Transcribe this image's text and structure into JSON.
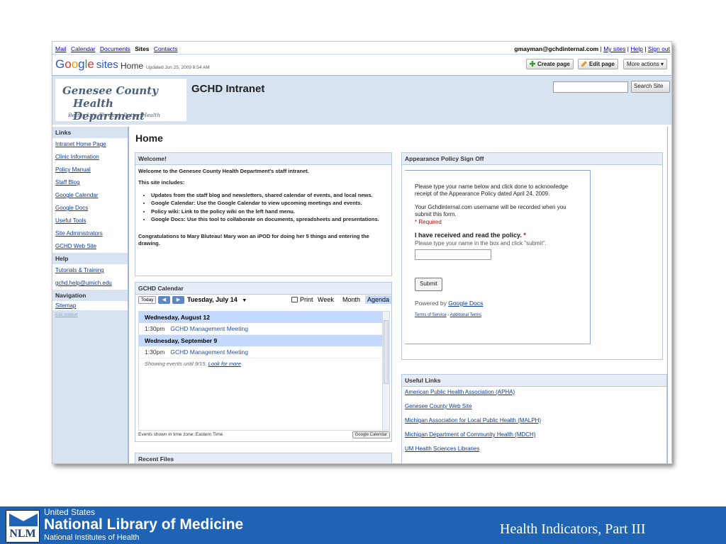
{
  "gbar": {
    "links": [
      "Mail",
      "Calendar",
      "Documents"
    ],
    "current": "Sites",
    "contacts": "Contacts",
    "user": "gmayman@gchdinternal.com",
    "sep": "|",
    "mysites": "My sites",
    "help": "Help",
    "signout": "Sign out"
  },
  "sites": {
    "logo_google": [
      "G",
      "o",
      "o",
      "g",
      "l",
      "e"
    ],
    "logo_sites": "sites",
    "page": "Home",
    "updated": "Updated Jun 25, 2009 6:54 AM",
    "create_page": "Create page",
    "edit_page": "Edit page",
    "more_actions": "More actions ▾"
  },
  "header": {
    "logo_line1": "Genesee County",
    "logo_line2": "Health Department",
    "logo_tagline": "Better Life Through Better Health",
    "site_title": "GCHD Intranet",
    "search_button": "Search Site"
  },
  "sidebar": {
    "links_title": "Links",
    "links": [
      "Intranet Home Page",
      "Clinic Information",
      "Policy Manual",
      "Staff Blog",
      "Google Calendar",
      "Google Docs",
      "Useful Tools",
      "Site Administrators",
      "GCHD Web Site"
    ],
    "help_title": "Help",
    "help": [
      "Tutorials & Training",
      "gchd.help@umich.edu"
    ],
    "nav_title": "Navigation",
    "nav": [
      "Sitemap"
    ],
    "edit_sidebar": "Edit sidebar"
  },
  "main": {
    "title": "Home",
    "welcome": {
      "title": "Welcome!",
      "intro": "Welcome to the Genesee County Health Department's staff intranet.",
      "includes": "This site includes:",
      "items": [
        "Updates from the staff blog and newsletters, shared calendar of events, and local news.",
        "Google Calendar:  Use the Google Calendar to view upcoming meetings and events.",
        "Policy wiki: Link to the policy wiki on the left hand menu.",
        "Google Docs: Use this tool to collaborate on documents, spreadsheets and presentations."
      ],
      "congrats": "Congratulations to Mary Bluteau! Mary won an iPOD for doing her 5 things and entering the drawing."
    },
    "calendar": {
      "title": "GCHD Calendar",
      "today": "Today",
      "prev": "◀",
      "next": "▶",
      "date": "Tuesday, July 14",
      "dropdown": "▼",
      "print": "Print",
      "views": [
        "Week",
        "Month",
        "Agenda"
      ],
      "days": [
        {
          "day": "Wednesday, August 12",
          "time": "1:30pm",
          "event": "GCHD Management Meeting"
        },
        {
          "day": "Wednesday, September 9",
          "time": "1:30pm",
          "event": "GCHD Management Meeting"
        }
      ],
      "showing": "Showing events until 9/15.",
      "look_more": "Look for more",
      "timezone": "Events shown in time zone: Eastern Time",
      "badge": "Google Calendar"
    },
    "recent": {
      "title": "Recent Files"
    },
    "appearance": {
      "title": "Appearance Policy Sign Off",
      "p1": "Please type your name below and click done to acknowledge receipt of the Appearance Policy dated April 24, 2009.",
      "p2": "Your Gchdinternal.com username will be recorded when you submit this form.",
      "required": "* Required",
      "question": "I have received and read the policy.",
      "star": " *",
      "hint": "Please type your name in the box and click \"submit\".",
      "submit": "Submit",
      "powered": "Powered by",
      "gdocs": "Google Docs",
      "terms": "Terms of Service",
      "dash": " - ",
      "additional": "Additional Terms"
    },
    "useful": {
      "title": "Useful Links",
      "links": [
        "American Public Health Association (APHA)",
        "Genesee County Web Site",
        "Michigan Association for Local Public Health (MALPH)",
        "Michigan Department of Community Health (MDCH)",
        "UM Health Sciences Libraries"
      ]
    }
  },
  "slide_footer": {
    "nlm_logo": "NLM",
    "line1": "United States",
    "line2": "National Library of Medicine",
    "line3": "National Institutes of Health",
    "title": "Health Indicators, Part III"
  },
  "colors": {
    "header_band": "#d7e3f1",
    "link": "#0b3b9c",
    "footer": "#1f63b4"
  }
}
